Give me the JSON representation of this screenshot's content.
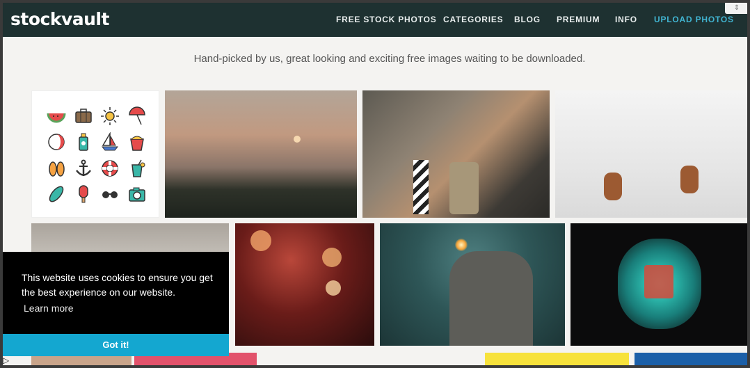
{
  "brand": {
    "logo": "stockvault"
  },
  "nav": {
    "items": [
      {
        "label": "FREE STOCK PHOTOS"
      },
      {
        "label": "CATEGORIES"
      },
      {
        "label": "BLOG"
      },
      {
        "label": "PREMIUM"
      },
      {
        "label": "INFO"
      },
      {
        "label": "UPLOAD PHOTOS"
      }
    ],
    "accent_color": "#41b5d2",
    "background": "#1e3131"
  },
  "tagline": "Hand-picked by us, great looking and exciting free images waiting to be downloaded.",
  "gallery": {
    "icon_set": [
      "watermelon-icon",
      "suitcase-icon",
      "sun-icon",
      "umbrella-icon",
      "beach-ball-icon",
      "sunscreen-icon",
      "sailboat-icon",
      "sand-bucket-icon",
      "flip-flops-icon",
      "anchor-icon",
      "life-ring-icon",
      "drink-icon",
      "surfboard-icon",
      "popsicle-icon",
      "sunglasses-icon",
      "camera-icon"
    ]
  },
  "cookie_banner": {
    "message": "This website uses cookies to ensure you get the best experience on our website.",
    "link": "Learn more",
    "button": "Got it!",
    "button_color": "#14a7d0"
  }
}
